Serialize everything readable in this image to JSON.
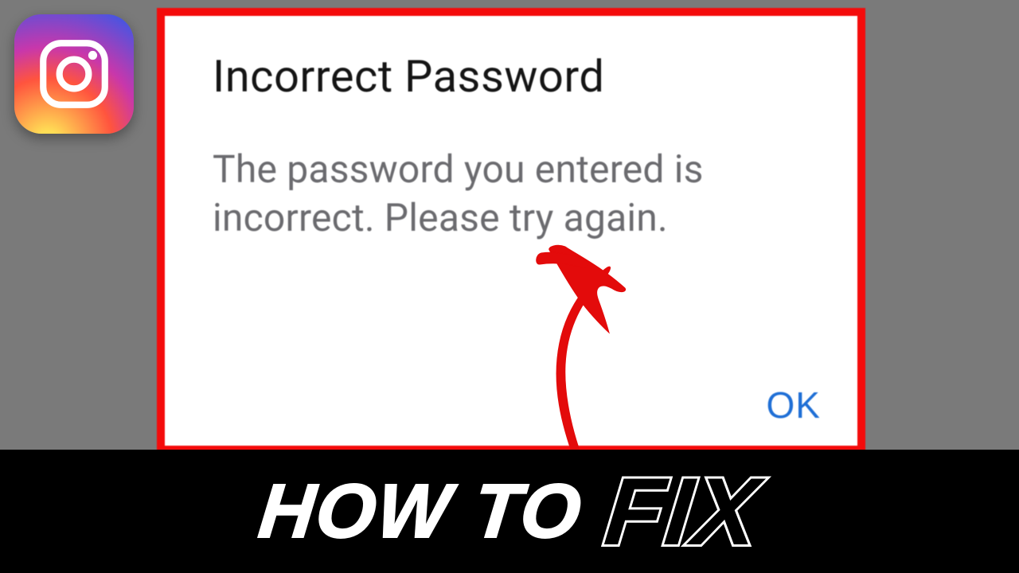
{
  "app_icon": {
    "name": "instagram-icon"
  },
  "dialog": {
    "title": "Incorrect Password",
    "body": "The password you entered is incorrect. Please try again.",
    "ok_label": "OK",
    "border_color": "#f40b0b"
  },
  "banner": {
    "howto_text": "HOW TO",
    "fix_text": "FIX"
  },
  "colors": {
    "background": "#7a7a7a",
    "accent_red": "#e30b0b",
    "link_blue": "#1f6fd6"
  }
}
